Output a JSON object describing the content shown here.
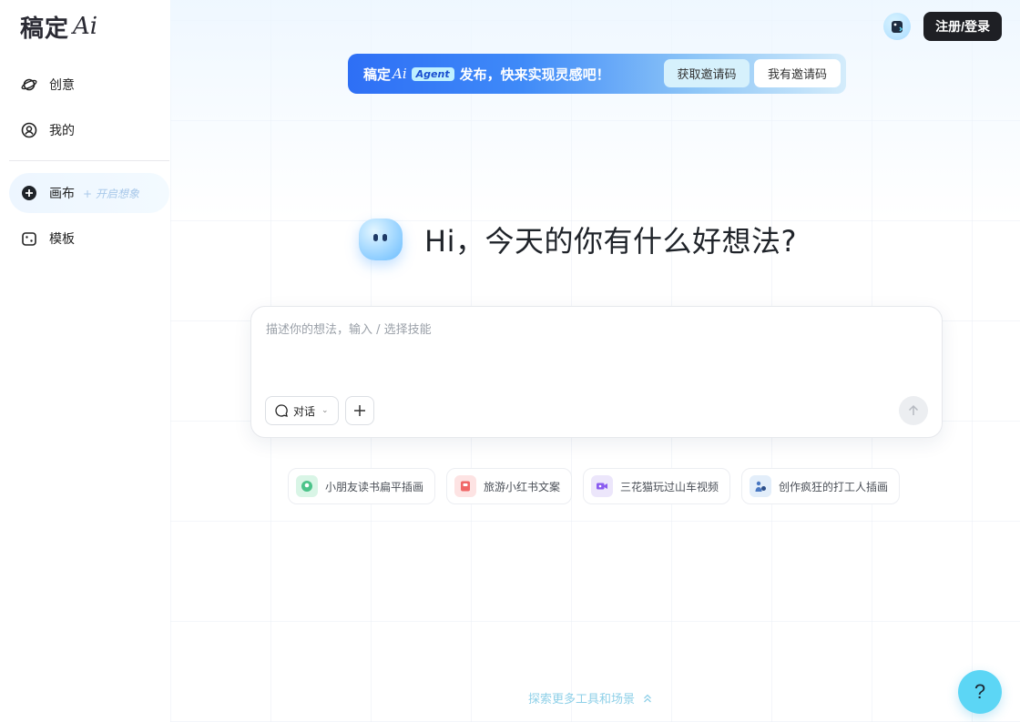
{
  "logo": {
    "text": "稿定",
    "ai": "Ai"
  },
  "sidebar": {
    "items": [
      {
        "label": "创意",
        "icon": "planet-icon"
      },
      {
        "label": "我的",
        "icon": "user-circle-icon"
      },
      {
        "label": "画布",
        "hint": "+ 开启想象",
        "icon": "plus-circle-icon"
      },
      {
        "label": "模板",
        "icon": "template-card-icon"
      }
    ]
  },
  "header": {
    "login_label": "注册/登录"
  },
  "banner": {
    "brand": "稿定",
    "brand_ai": "Ai",
    "tag": "Agent",
    "text": "发布，快来实现灵感吧！",
    "get_code_label": "获取邀请码",
    "have_code_label": "我有邀请码"
  },
  "greeting": "Hi，今天的你有什么好想法?",
  "composer": {
    "placeholder": "描述你的想法，输入 / 选择技能",
    "mode_label": "对话"
  },
  "suggestions": [
    {
      "label": "小朋友读书扁平插画",
      "icon": "book-reading-icon",
      "color": "#d9f5e6"
    },
    {
      "label": "旅游小红书文案",
      "icon": "red-note-icon",
      "color": "#fde3e3"
    },
    {
      "label": "三花猫玩过山车视频",
      "icon": "video-camera-icon",
      "color": "#ece6fb"
    },
    {
      "label": "创作疯狂的打工人插画",
      "icon": "worker-icon",
      "color": "#e3eefa"
    }
  ],
  "explore_label": "探索更多工具和场景",
  "help_label": "?",
  "colors": {
    "accent": "#3f8af8",
    "help": "#5cd6f5",
    "login_bg": "#1e1f24"
  }
}
